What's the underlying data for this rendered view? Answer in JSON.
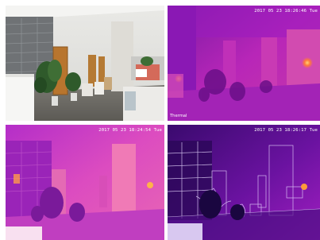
{
  "panels": [
    {
      "mode": "visible",
      "timestamp": "",
      "label": ""
    },
    {
      "mode": "thermal",
      "timestamp": "2017 05 23 18:26:46 Tue",
      "label": "Thermal"
    },
    {
      "mode": "fusion",
      "timestamp": "2017 05 23 18:24:54 Tue",
      "label": ""
    },
    {
      "mode": "edge-fusion",
      "timestamp": "2017 05 23 18:26:17 Tue",
      "label": ""
    }
  ],
  "colors": {
    "thermal_dark": "#3a0a6e",
    "thermal_mid": "#b820c8",
    "thermal_hot": "#ff8a3a",
    "fusion_pink": "#e040c8"
  }
}
